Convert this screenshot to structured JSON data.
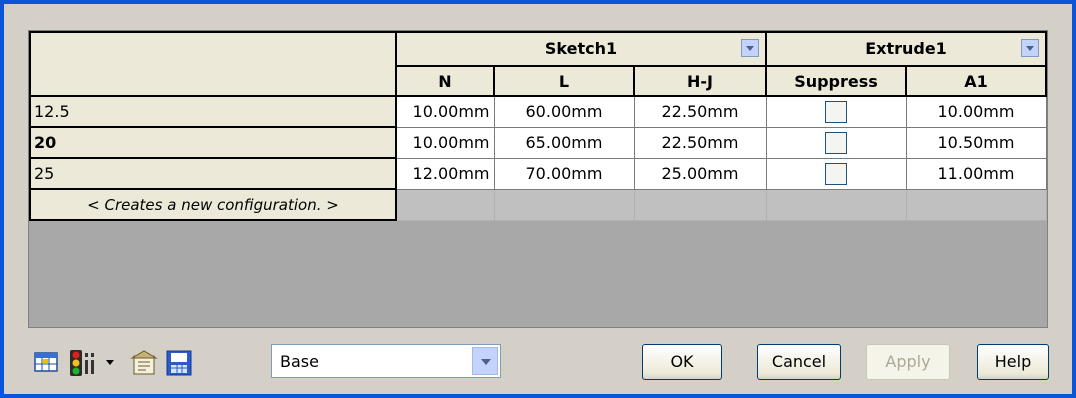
{
  "table": {
    "groups": [
      {
        "label": "Sketch1",
        "dropdown_icon": "chevron-down-icon"
      },
      {
        "label": "Extrude1",
        "dropdown_icon": "chevron-down-icon"
      }
    ],
    "columns": [
      "N",
      "L",
      "H-J",
      "Suppress",
      "A1"
    ],
    "rows": [
      {
        "name": "12.5",
        "bold": false,
        "N": "10.00mm",
        "L": "60.00mm",
        "HJ": "22.50mm",
        "suppress": false,
        "A1": "10.00mm"
      },
      {
        "name": "20",
        "bold": true,
        "N": "10.00mm",
        "L": "65.00mm",
        "HJ": "22.50mm",
        "suppress": false,
        "A1": "10.50mm"
      },
      {
        "name": "25",
        "bold": false,
        "N": "12.00mm",
        "L": "70.00mm",
        "HJ": "25.00mm",
        "suppress": false,
        "A1": "11.00mm"
      }
    ],
    "new_row_label": "< Creates a new configuration. >"
  },
  "toolbar": {
    "icons": [
      "table-view-icon",
      "traffic-light-icon",
      "dropdown-arrow-icon",
      "properties-icon",
      "save-table-icon"
    ],
    "combo_value": "Base",
    "buttons": {
      "ok": "OK",
      "cancel": "Cancel",
      "apply": "Apply",
      "help": "Help"
    }
  },
  "colors": {
    "window_border": "#0a55d8",
    "dialog_bg": "#d4d0c8",
    "header_bg": "#ece9d8",
    "empty_area": "#a8a8a8"
  }
}
